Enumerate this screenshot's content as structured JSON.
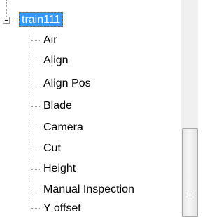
{
  "tree": {
    "root": {
      "label": "train111",
      "expanded": true,
      "selected": true,
      "children": [
        {
          "label": "Air"
        },
        {
          "label": "Align"
        },
        {
          "label": "Align Pos"
        },
        {
          "label": "Blade"
        },
        {
          "label": "Camera"
        },
        {
          "label": "Cut"
        },
        {
          "label": "Height"
        },
        {
          "label": "Manual Inspection"
        },
        {
          "label": "Y offset"
        }
      ]
    }
  },
  "colors": {
    "selection": "#3399ff",
    "selection_text": "#ffffff",
    "scrollbar_track": "#f0f0f0"
  }
}
